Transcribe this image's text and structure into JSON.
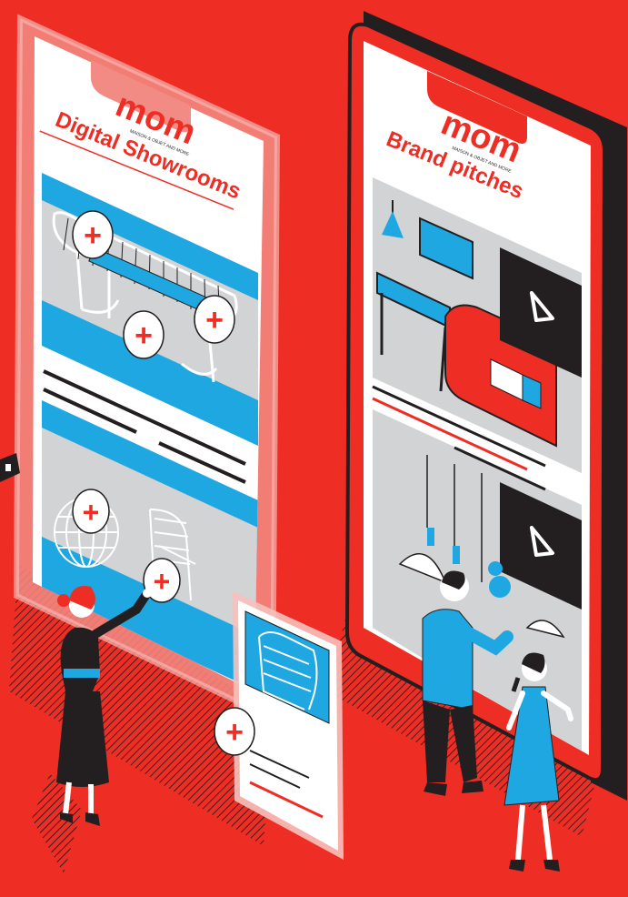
{
  "colors": {
    "background": "#ee2e24",
    "accent_blue": "#1ea7e1",
    "dark": "#231f20",
    "light_gray": "#d1d3d4",
    "white": "#ffffff"
  },
  "left_phone": {
    "logo": "mom",
    "logo_tagline": "MAISON & OBJET AND MORE",
    "title": "Digital Showrooms",
    "plus_symbol": "+"
  },
  "right_phone": {
    "logo": "mom",
    "logo_tagline": "MAISON & OBJET AND MORE",
    "title": "Brand pitches",
    "play_icon": "play-icon"
  },
  "floating_card": {
    "plus_symbol": "+"
  },
  "icons": [
    "plus-icon",
    "play-icon"
  ]
}
